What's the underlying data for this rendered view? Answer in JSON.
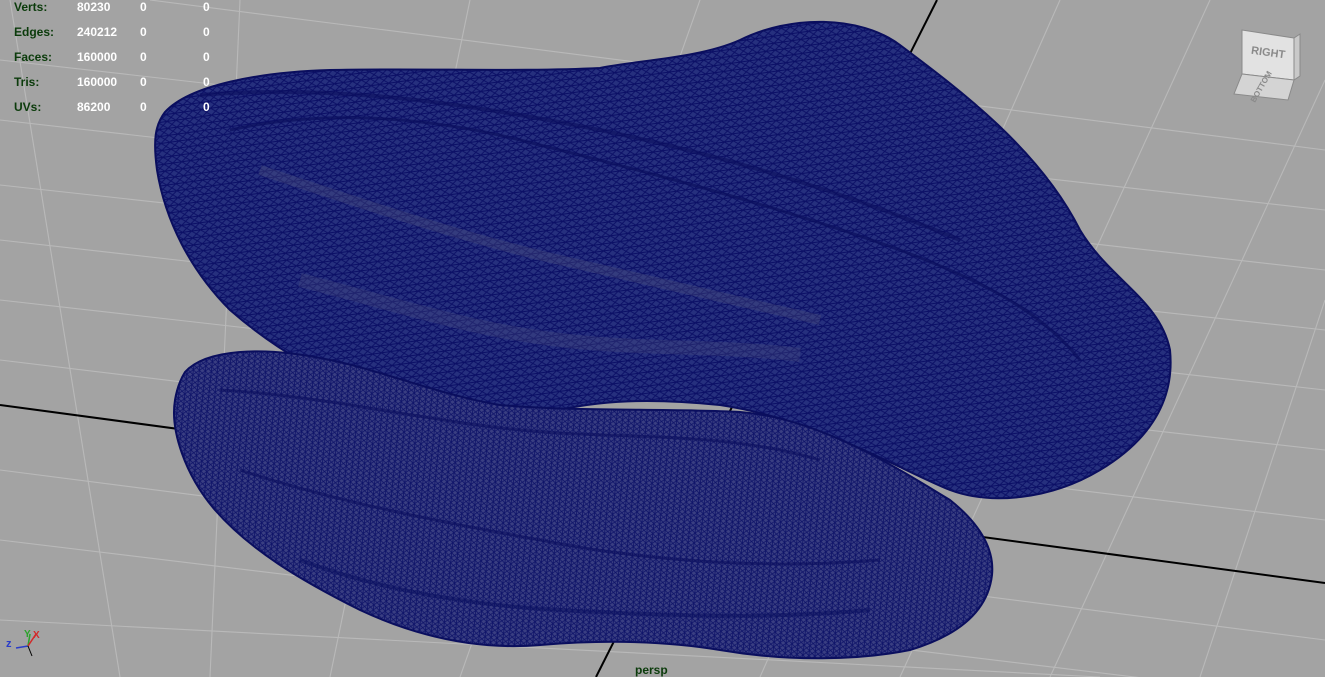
{
  "hud": {
    "rows": [
      {
        "label": "Verts:",
        "v1": "80230",
        "v2": "0",
        "v3": "0"
      },
      {
        "label": "Edges:",
        "v1": "240212",
        "v2": "0",
        "v3": "0"
      },
      {
        "label": "Faces:",
        "v1": "160000",
        "v2": "0",
        "v3": "0"
      },
      {
        "label": "Tris:",
        "v1": "160000",
        "v2": "0",
        "v3": "0"
      },
      {
        "label": "UVs:",
        "v1": "86200",
        "v2": "0",
        "v3": "0"
      }
    ]
  },
  "view_cube": {
    "face_front": "RIGHT",
    "face_bottom": "BOTTOM"
  },
  "axis": {
    "z": "z",
    "y": "Y",
    "x": "X"
  },
  "camera": {
    "label": "persp"
  },
  "colors": {
    "viewport_bg": "#a3a3a3",
    "grid": "#bcbcbc",
    "axis_line": "#000000",
    "mesh_fill": "#1e2478",
    "mesh_wire": "#0c1070",
    "hud_label": "#0b3b0b",
    "hud_value": "#ffffff"
  }
}
